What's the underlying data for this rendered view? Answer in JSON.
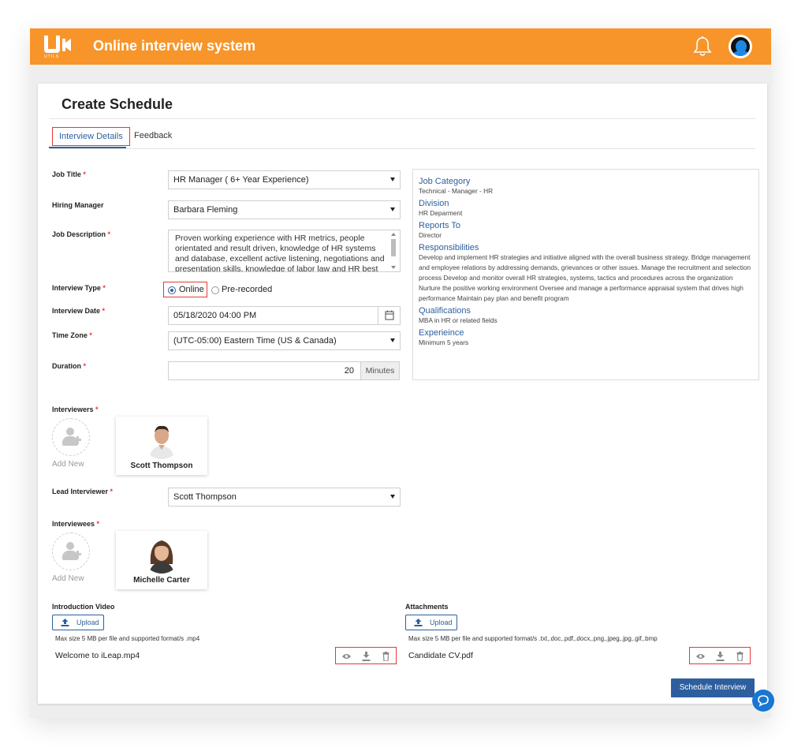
{
  "header": {
    "logo_sub": "UTILS",
    "title": "Online interview system"
  },
  "page": {
    "title": "Create Schedule",
    "tabs": [
      {
        "label": "Interview Details",
        "active": true
      },
      {
        "label": "Feedback",
        "active": false
      }
    ]
  },
  "form": {
    "job_title": {
      "label": "Job Title",
      "required": "*",
      "value": "HR Manager ( 6+ Year Experience)"
    },
    "hiring_manager": {
      "label": "Hiring Manager",
      "value": "Barbara Fleming"
    },
    "job_description": {
      "label": "Job Description",
      "required": "*",
      "value": "Proven working experience with HR metrics, people orientated and result driven, knowledge of HR systems and database, excellent active listening, negotiations and presentation skills, knowledge of labor law and HR best practices"
    },
    "interview_type": {
      "label": "Interview Type",
      "required": "*",
      "options": [
        "Online",
        "Pre-recorded"
      ],
      "selected": "Online"
    },
    "interview_date": {
      "label": "Interview Date",
      "required": "*",
      "value": "05/18/2020 04:00 PM"
    },
    "time_zone": {
      "label": "Time Zone",
      "required": "*",
      "value": "(UTC-05:00) Eastern Time (US & Canada)"
    },
    "duration": {
      "label": "Duration",
      "required": "*",
      "value": "20",
      "unit": "Minutes"
    },
    "interviewers": {
      "label": "Interviewers",
      "required": "*",
      "add_label": "Add New",
      "people": [
        "Scott Thompson"
      ]
    },
    "lead_interviewer": {
      "label": "Lead Interviewer",
      "required": "*",
      "value": "Scott Thompson"
    },
    "interviewees": {
      "label": "Interviewees",
      "required": "*",
      "add_label": "Add New",
      "people": [
        "Michelle Carter"
      ]
    }
  },
  "info": [
    {
      "heading": "Job Category",
      "value": "Technical - Manager - HR"
    },
    {
      "heading": "Division",
      "value": "HR Deparment"
    },
    {
      "heading": "Reports To",
      "value": "Director"
    },
    {
      "heading": "Responsibilities",
      "value": "Develop and implement HR strategies and initiative aligned with the overall business strategy. Bridge management and employee relations by addressing demands, grievances or other issues. Manage the recruitment and selection process Develop and monitor overall HR strategies, systems, tactics and procedures across the organization Nurture the positive working environment Oversee and manage a performance appraisal system that drives high performance Maintain pay plan and benefit program"
    },
    {
      "heading": "Qualifications",
      "value": "MBA in HR or related fields"
    },
    {
      "heading": "Experieince",
      "value": "Minimum 5 years"
    }
  ],
  "intro_video": {
    "label": "Introduction Video",
    "upload_label": "Upload",
    "hint": "Max size 5 MB per file and supported format/s .mp4",
    "file": "Welcome to iLeap.mp4"
  },
  "attachments": {
    "label": "Attachments",
    "upload_label": "Upload",
    "hint": "Max size 5 MB per file and supported format/s .txt,.doc,.pdf,.docx,.png,.jpeg,.jpg,.gif,.bmp",
    "file": "Candidate CV.pdf"
  },
  "actions": {
    "schedule_label": "Schedule Interview"
  },
  "colors": {
    "header": "#f7952a",
    "accent": "#2d5f9e",
    "highlight": "#e53935"
  }
}
